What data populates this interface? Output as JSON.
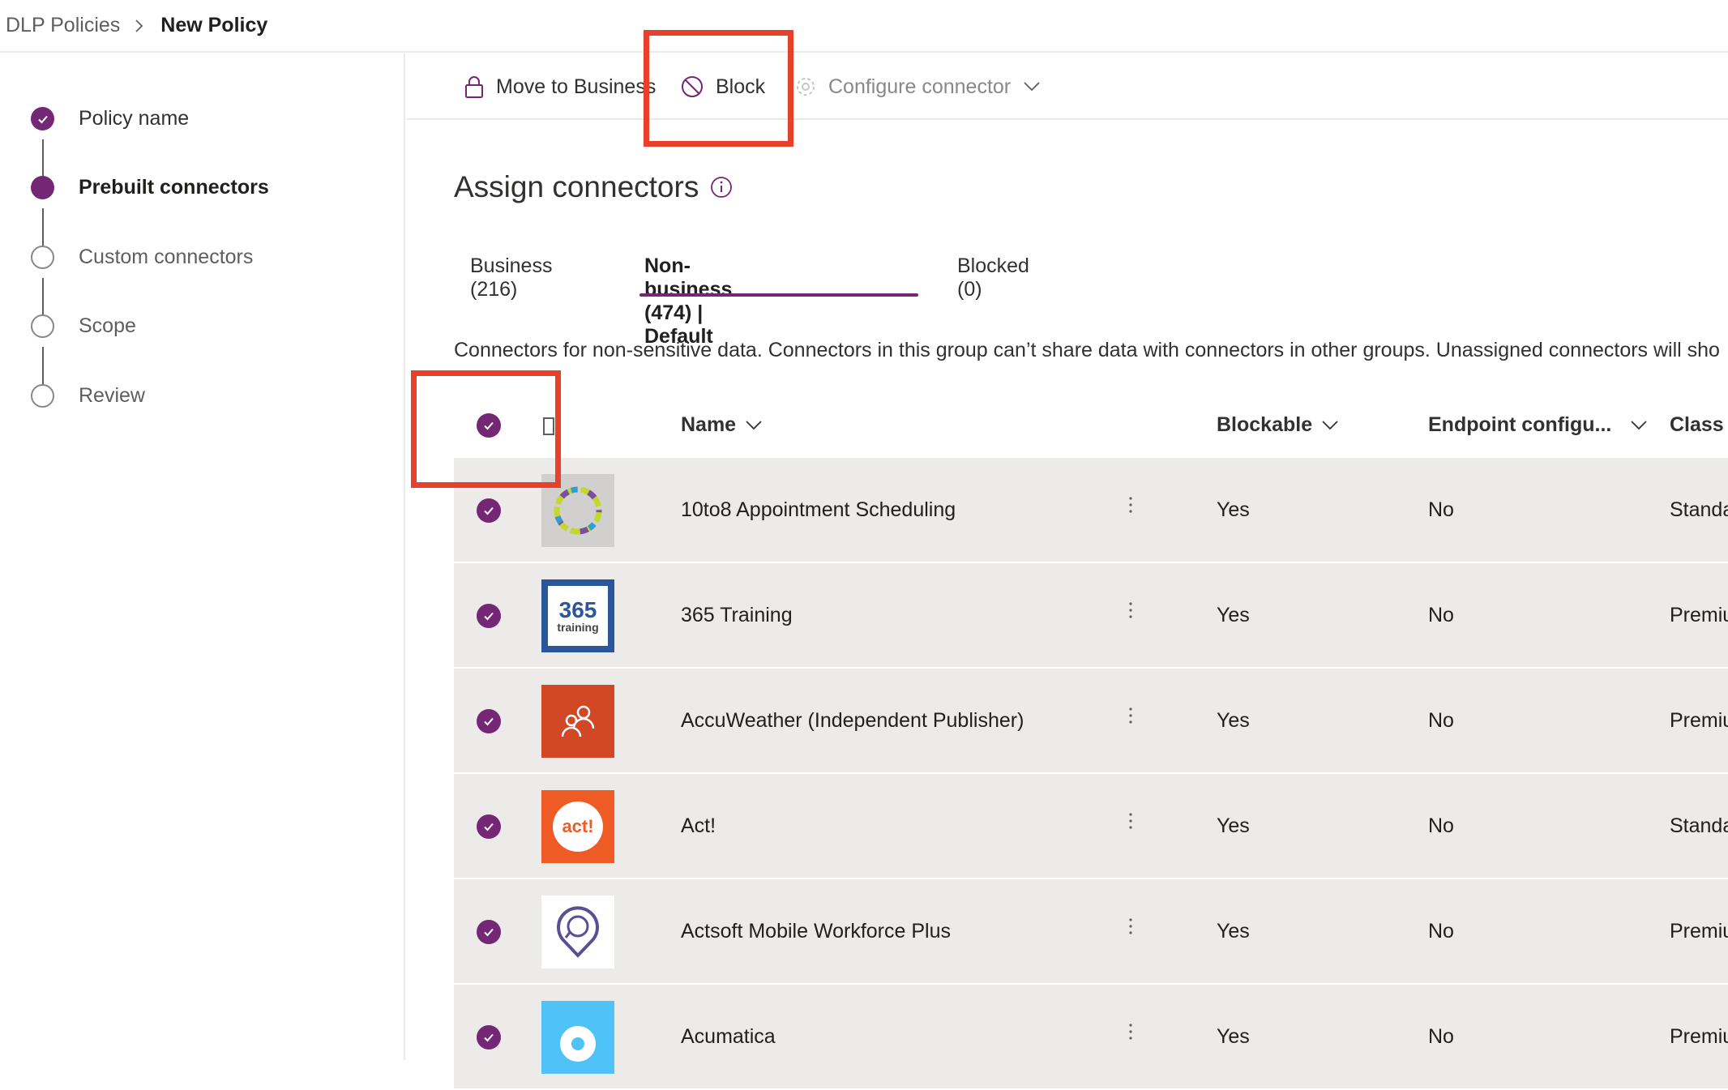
{
  "breadcrumb": {
    "parent": "DLP Policies",
    "current": "New Policy"
  },
  "steps": [
    {
      "label": "Policy name",
      "state": "done"
    },
    {
      "label": "Prebuilt connectors",
      "state": "current"
    },
    {
      "label": "Custom connectors",
      "state": "todo"
    },
    {
      "label": "Scope",
      "state": "todo"
    },
    {
      "label": "Review",
      "state": "todo"
    }
  ],
  "commands": {
    "move_to_business": "Move to Business",
    "block": "Block",
    "configure_connector": "Configure connector"
  },
  "page": {
    "title": "Assign connectors",
    "description": "Connectors for non-sensitive data. Connectors in this group can’t share data with connectors in other groups. Unassigned connectors will sho"
  },
  "tabs": [
    {
      "label": "Business (216)"
    },
    {
      "label": "Non-business (474) | Default",
      "active": true
    },
    {
      "label": "Blocked (0)"
    }
  ],
  "table": {
    "columns": {
      "name": "Name",
      "blockable": "Blockable",
      "endpoint": "Endpoint configu...",
      "class": "Class"
    },
    "rows": [
      {
        "name": "10to8 Appointment Scheduling",
        "blockable": "Yes",
        "endpoint": "No",
        "class": "Standa",
        "logo": "ring-logo"
      },
      {
        "name": "365 Training",
        "blockable": "Yes",
        "endpoint": "No",
        "class": "Premiu",
        "logo": "365-training-logo",
        "logo_text": "365",
        "logo_subtext": "training"
      },
      {
        "name": "AccuWeather (Independent Publisher)",
        "blockable": "Yes",
        "endpoint": "No",
        "class": "Premiu",
        "logo": "people-logo"
      },
      {
        "name": "Act!",
        "blockable": "Yes",
        "endpoint": "No",
        "class": "Standa",
        "logo": "act-logo",
        "logo_text": "act!"
      },
      {
        "name": "Actsoft Mobile Workforce Plus",
        "blockable": "Yes",
        "endpoint": "No",
        "class": "Premiu",
        "logo": "map-pin-logo"
      },
      {
        "name": "Acumatica",
        "blockable": "Yes",
        "endpoint": "No",
        "class": "Premiu",
        "logo": "acumatica-logo"
      }
    ]
  },
  "colors": {
    "accent": "#742774",
    "highlight": "#e8412b",
    "row_bg": "#edebe9"
  }
}
